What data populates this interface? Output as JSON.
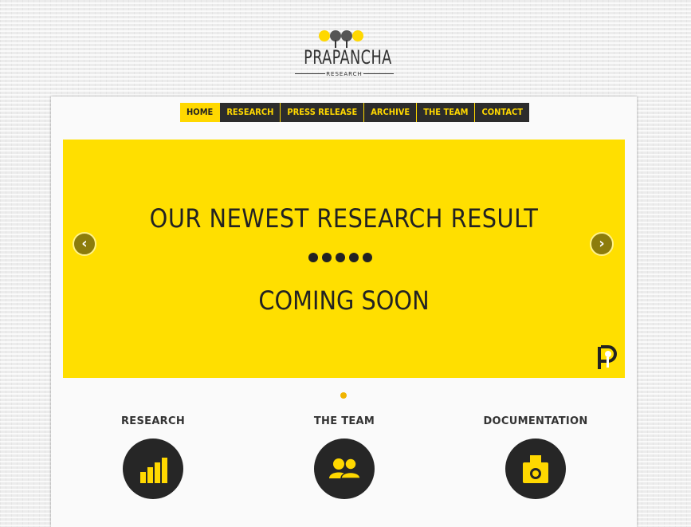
{
  "logo": {
    "name": "PRAPANCHA",
    "sub": "RESEARCH",
    "dot_colors": [
      "#ffd800",
      "#555555",
      "#555555",
      "#ffd800"
    ]
  },
  "nav": {
    "items": [
      {
        "label": "HOME",
        "active": true
      },
      {
        "label": "RESEARCH"
      },
      {
        "label": "PRESS RELEASE"
      },
      {
        "label": "ARCHIVE"
      },
      {
        "label": "THE TEAM"
      },
      {
        "label": "CONTACT"
      }
    ]
  },
  "slider": {
    "title": "OUR NEWEST RESEARCH RESULT",
    "subtitle": "COMING SOON",
    "prev_icon": "chevron-left-icon",
    "next_icon": "chevron-right-icon",
    "background": "#ffdf00"
  },
  "features": [
    {
      "title": "RESEARCH",
      "icon": "bar-chart-icon"
    },
    {
      "title": "THE TEAM",
      "icon": "team-icon"
    },
    {
      "title": "DOCUMENTATION",
      "icon": "camera-icon"
    }
  ],
  "colors": {
    "accent": "#ffd800",
    "dark": "#2c2c2c",
    "pager_active": "#f0b400"
  }
}
